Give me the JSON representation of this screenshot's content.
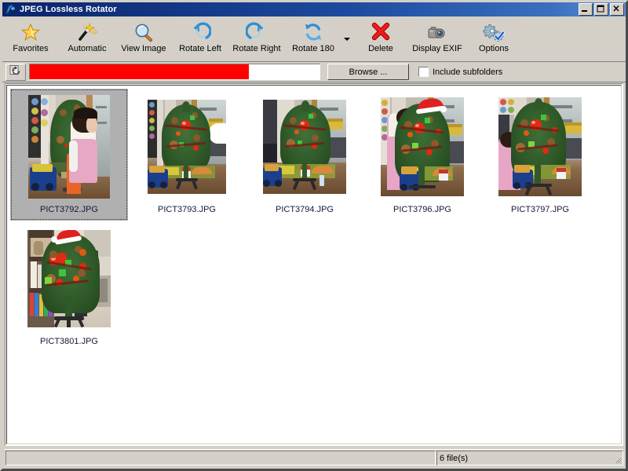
{
  "window": {
    "title": "JPEG Lossless Rotator",
    "icon": "app-icon",
    "controls": {
      "minimize": "minimize-button",
      "maximize": "maximize-button",
      "close": "close-button"
    }
  },
  "toolbar": {
    "buttons": [
      {
        "label": "Favorites",
        "icon": "star-icon"
      },
      {
        "label": "Automatic",
        "icon": "magic-wand-icon"
      },
      {
        "label": "View Image",
        "icon": "magnifier-icon"
      },
      {
        "label": "Rotate Left",
        "icon": "rotate-left-icon"
      },
      {
        "label": "Rotate Right",
        "icon": "rotate-right-icon"
      },
      {
        "label": "Rotate 180",
        "icon": "rotate-180-icon"
      },
      {
        "label": "Delete",
        "icon": "red-x-icon"
      },
      {
        "label": "Display EXIF",
        "icon": "camera-icon"
      },
      {
        "label": "Options",
        "icon": "gears-check-icon"
      }
    ],
    "dropdown_after": "Rotate 180",
    "dropdown_icon": "chevron-down-icon"
  },
  "pathbar": {
    "folder_button_icon": "folder-refresh-icon",
    "path_value": "",
    "path_redacted": true,
    "redaction_color": "#fe0000",
    "browse_label": "Browse ...",
    "include_subfolders_label": "Include subfolders",
    "include_subfolders_checked": false
  },
  "files": [
    {
      "name": "PICT3792.JPG",
      "selected": true,
      "orientation": "portrait",
      "scene": "child-in-pink-beside-christmas-tree"
    },
    {
      "name": "PICT3793.JPG",
      "selected": false,
      "orientation": "portrait",
      "scene": "christmas-tree-with-ornaments"
    },
    {
      "name": "PICT3794.JPG",
      "selected": false,
      "orientation": "portrait",
      "scene": "christmas-tree-wide-room"
    },
    {
      "name": "PICT3796.JPG",
      "selected": false,
      "orientation": "portrait",
      "scene": "christmas-tree-with-santa-hat-and-child-arm"
    },
    {
      "name": "PICT3797.JPG",
      "selected": false,
      "orientation": "portrait",
      "scene": "christmas-tree-with-child-in-pink-left"
    },
    {
      "name": "PICT3801.JPG",
      "selected": false,
      "orientation": "portrait",
      "scene": "christmas-tree-santa-hat-bookshelf-room"
    }
  ],
  "statusbar": {
    "left_text": "",
    "right_text": "6 file(s)",
    "grip_icon": "resize-grip-icon"
  },
  "colors": {
    "titlebar_start": "#0a246a",
    "titlebar_end": "#5b8fd6",
    "face": "#d4d0c8",
    "panel": "#ffffff",
    "selection": "#b0b0b0",
    "accent_red": "#fe0000",
    "label_text": "#17173a"
  }
}
